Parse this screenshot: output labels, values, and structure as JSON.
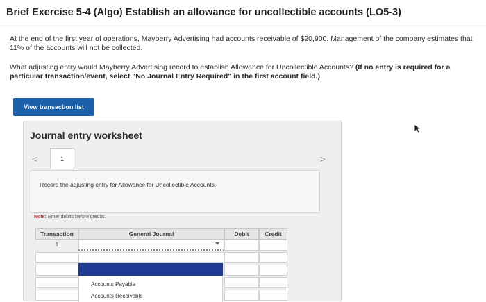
{
  "header": {
    "title": "Brief Exercise 5-4 (Algo) Establish an allowance for uncollectible accounts (LO5-3)"
  },
  "problem": {
    "paragraph1": "At the end of the first year of operations, Mayberry Advertising had accounts receivable of $20,900. Management of the company estimates that 11% of the accounts will not be collected.",
    "question": "What adjusting entry would Mayberry Advertising record to establish Allowance for Uncollectible Accounts?",
    "instruction_bold": "(If no entry is required for a particular transaction/event, select \"No Journal Entry Required\" in the first account field.)"
  },
  "buttons": {
    "view_transaction_list": "View transaction list"
  },
  "worksheet": {
    "title": "Journal entry worksheet",
    "prev_symbol": "<",
    "next_symbol": ">",
    "current_page": "1",
    "instruction": "Record the adjusting entry for Allowance for Uncollectible Accounts.",
    "note_label": "Note:",
    "note_text": "Enter debits before credits.",
    "table": {
      "headers": {
        "transaction": "Transaction",
        "general_journal": "General Journal",
        "debit": "Debit",
        "credit": "Credit"
      },
      "rows": [
        {
          "transaction": "1",
          "account": "",
          "debit": "",
          "credit": ""
        }
      ],
      "dropdown_options": [
        "Accounts Payable",
        "Accounts Receivable"
      ]
    }
  },
  "colors": {
    "button_blue": "#1a5fa8",
    "selected_input": "#1f3a93",
    "note_red": "#c62828"
  }
}
